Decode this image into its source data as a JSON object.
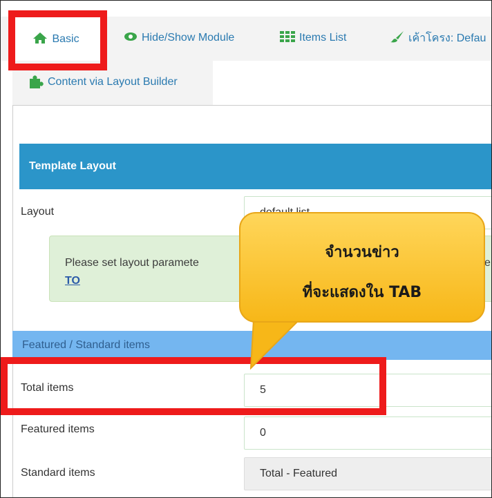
{
  "tabs": [
    {
      "label": "Basic",
      "icon": "home-icon"
    },
    {
      "label": "Hide/Show Module",
      "icon": "eye-icon"
    },
    {
      "label": "Items List",
      "icon": "grid-icon"
    },
    {
      "label": "เค้าโครง: Defau",
      "icon": "brush-icon"
    },
    {
      "label": "Content via Layout Builder",
      "icon": "puzzle-icon"
    }
  ],
  "section": {
    "title": "Template Layout"
  },
  "layout": {
    "label": "Layout",
    "value": "default list"
  },
  "notice": {
    "text": "Please set layout paramete",
    "text_tail": "e",
    "link": "TO"
  },
  "featured_header": "Featured / Standard items",
  "fields": [
    {
      "label": "Total items",
      "value": "5"
    },
    {
      "label": "Featured items",
      "value": "0"
    },
    {
      "label": "Standard items",
      "value": "Total - Featured"
    }
  ],
  "callout": {
    "line1": "จำนวนข่าว",
    "line2": "ที่จะแสดงใน TAB"
  },
  "colors": {
    "tab_text": "#2a7ab0",
    "section_header": "#2b95c9",
    "sub_header": "#74b6f0",
    "highlight": "#ee1b1b",
    "callout": "#f7b718"
  }
}
